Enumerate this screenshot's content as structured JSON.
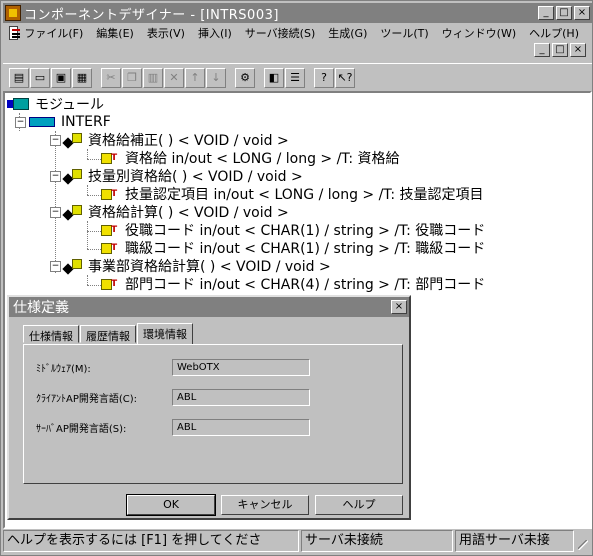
{
  "window": {
    "title": "コンポーネントデザイナー - [INTRS003]",
    "minimize": "_",
    "maximize": "□",
    "close": "×"
  },
  "menu": [
    "ファイル(F)",
    "編集(E)",
    "表示(V)",
    "挿入(I)",
    "サーバ接続(S)",
    "生成(G)",
    "ツール(T)",
    "ウィンドウ(W)",
    "ヘルプ(H)"
  ],
  "toolbar": {
    "buttons": [
      "new-icon",
      "open-icon",
      "save-icon",
      "print-icon",
      "cut-icon",
      "copy-icon",
      "paste-icon",
      "delete-icon",
      "up-arrow-icon",
      "down-arrow-icon",
      "gear-icon",
      "window-icon",
      "list-icon",
      "help-icon",
      "context-help-icon"
    ]
  },
  "tree": {
    "root": "モジュール",
    "interface": "INTERF",
    "methods": [
      {
        "label": "資格給補正( ) < VOID / void >",
        "params": [
          "資格給 in/out < LONG / long > /T: 資格給"
        ]
      },
      {
        "label": "技量別資格給( ) < VOID / void >",
        "params": [
          "技量認定項目 in/out < LONG / long > /T: 技量認定項目"
        ]
      },
      {
        "label": "資格給計算( ) < VOID / void >",
        "params": [
          "役職コード in/out < CHAR(1) / string > /T: 役職コード",
          "職級コード in/out < CHAR(1) / string > /T: 職級コード"
        ]
      },
      {
        "label": "事業部資格給計算( ) < VOID / void >",
        "params": [
          "部門コード in/out < CHAR(4) / string > /T: 部門コード"
        ]
      }
    ]
  },
  "dialog": {
    "title": "仕様定義",
    "close": "×",
    "tabs": [
      "仕様情報",
      "履歴情報",
      "環境情報"
    ],
    "active_tab": "環境情報",
    "fields": [
      {
        "label": "ﾐﾄﾞﾙｳｪｱ(M):",
        "value": "WebOTX"
      },
      {
        "label": "ｸﾗｲｱﾝﾄAP開発言語(C):",
        "value": "ABL"
      },
      {
        "label": "ｻｰﾊﾞAP開発言語(S):",
        "value": "ABL"
      }
    ],
    "buttons": {
      "ok": "OK",
      "cancel": "キャンセル",
      "help": "ヘルプ"
    }
  },
  "status": {
    "help": "ヘルプを表示するには [F1] を押してくださ",
    "server": "サーバ未接続",
    "term_server": "用語サーバ未接"
  }
}
